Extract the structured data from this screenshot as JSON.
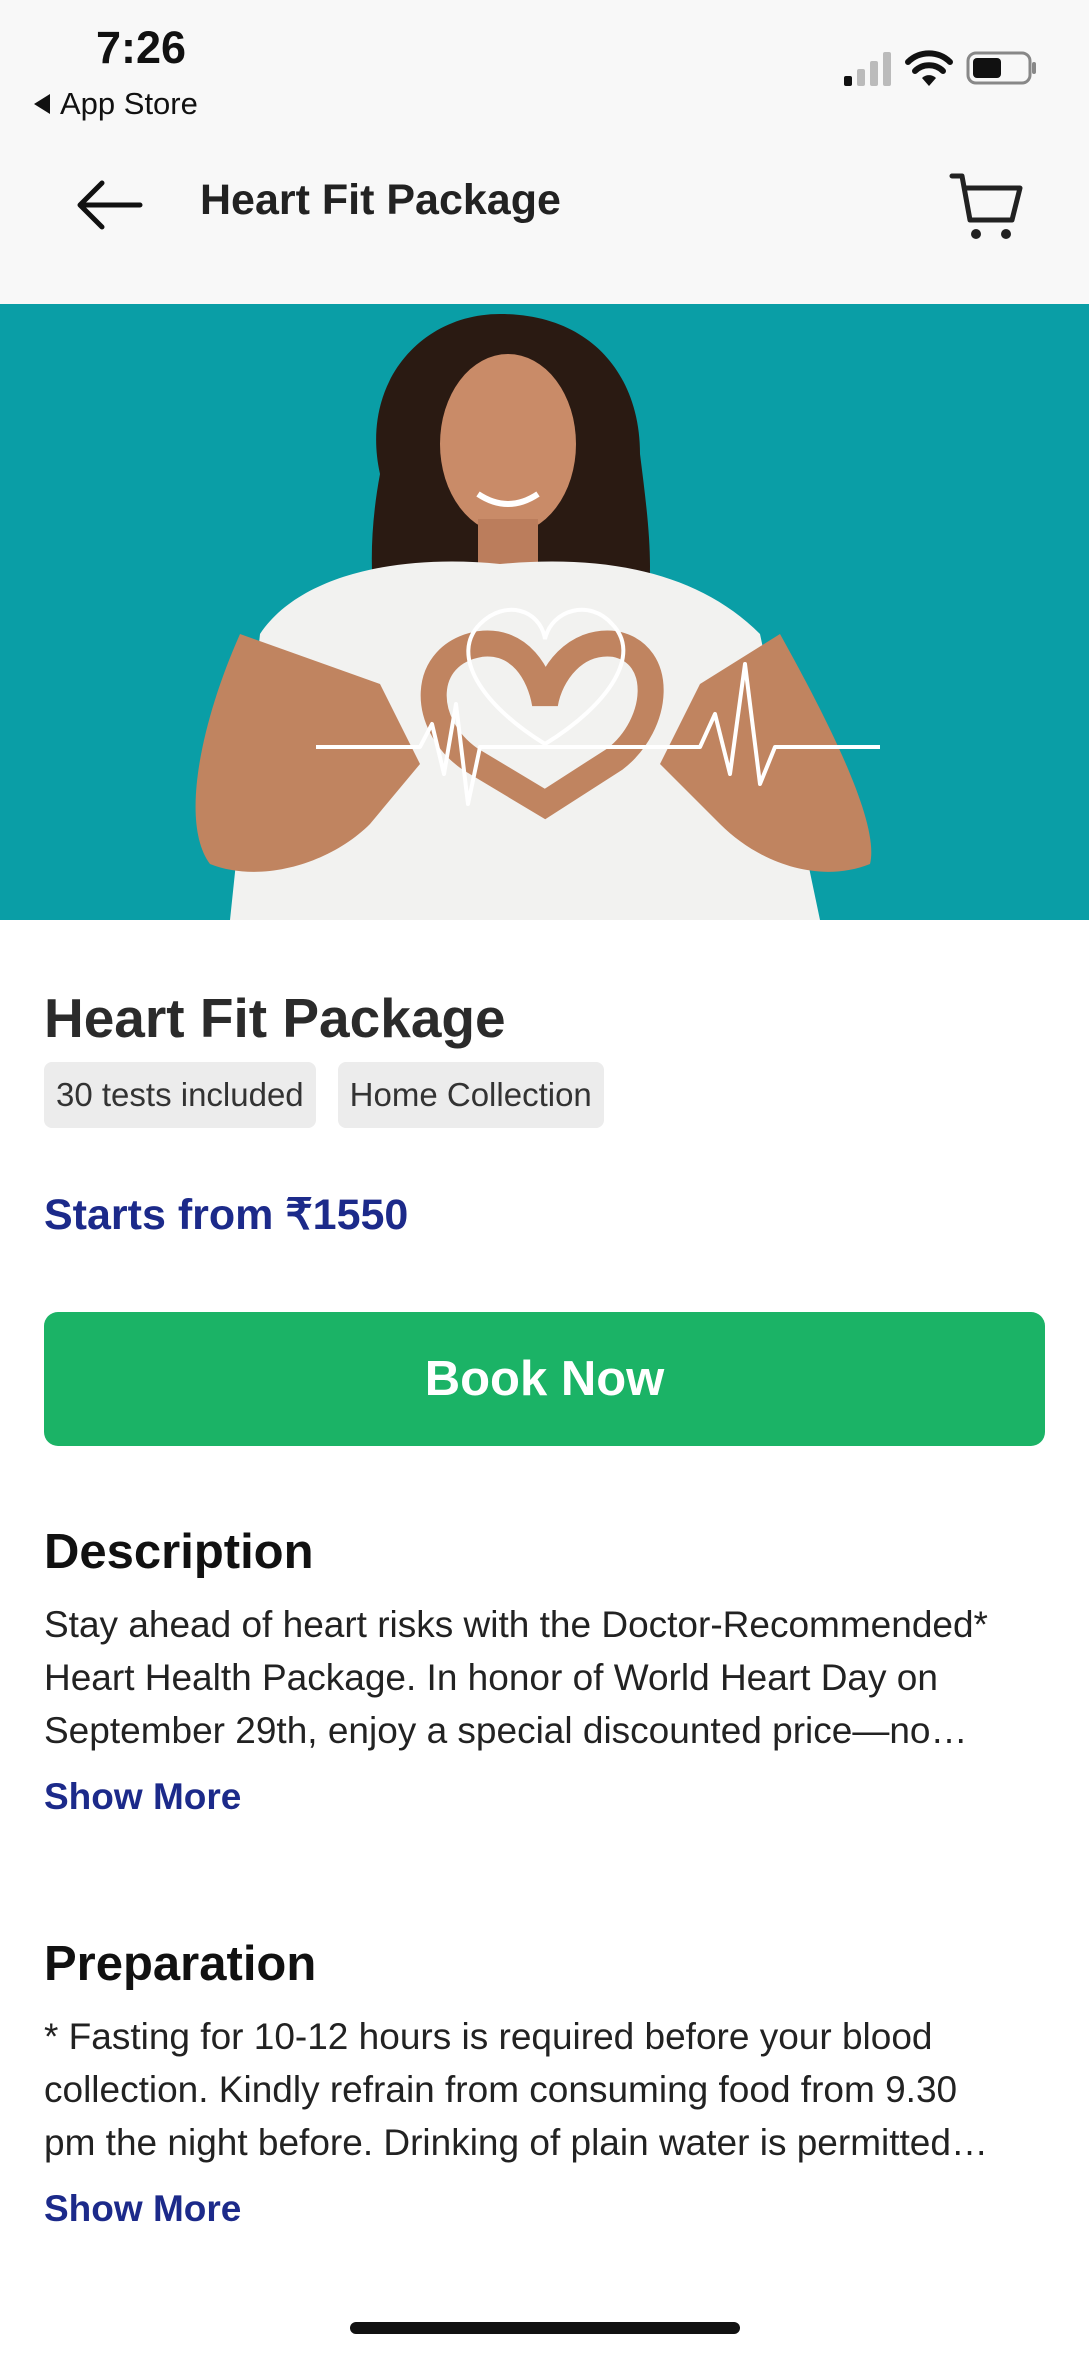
{
  "status": {
    "time": "7:26",
    "back_app": "App Store"
  },
  "header": {
    "title": "Heart Fit Package"
  },
  "package": {
    "title": "Heart Fit Package",
    "chips": [
      "30 tests included",
      "Home Collection"
    ],
    "price": "Starts from ₹1550",
    "book_label": "Book Now"
  },
  "description": {
    "title": "Description",
    "lines": [
      "Stay ahead of heart risks with the Doctor-Recommended*",
      "Heart Health Package. In honor of World Heart Day on",
      "September 29th, enjoy a special discounted price—no…"
    ],
    "show_more": "Show More"
  },
  "preparation": {
    "title": "Preparation",
    "lines": [
      "* Fasting for 10-12 hours is required before your blood",
      "collection. Kindly refrain from consuming food from 9.30",
      "pm the night before. Drinking of plain water is permitted…"
    ],
    "show_more": "Show More"
  },
  "colors": {
    "accent_blue": "#1c2a8a",
    "book_green": "#1bb366",
    "hero_teal": "#0a9ea6"
  },
  "icons": [
    "back-arrow-icon",
    "cart-icon",
    "signal-icon",
    "wifi-icon",
    "battery-icon"
  ]
}
